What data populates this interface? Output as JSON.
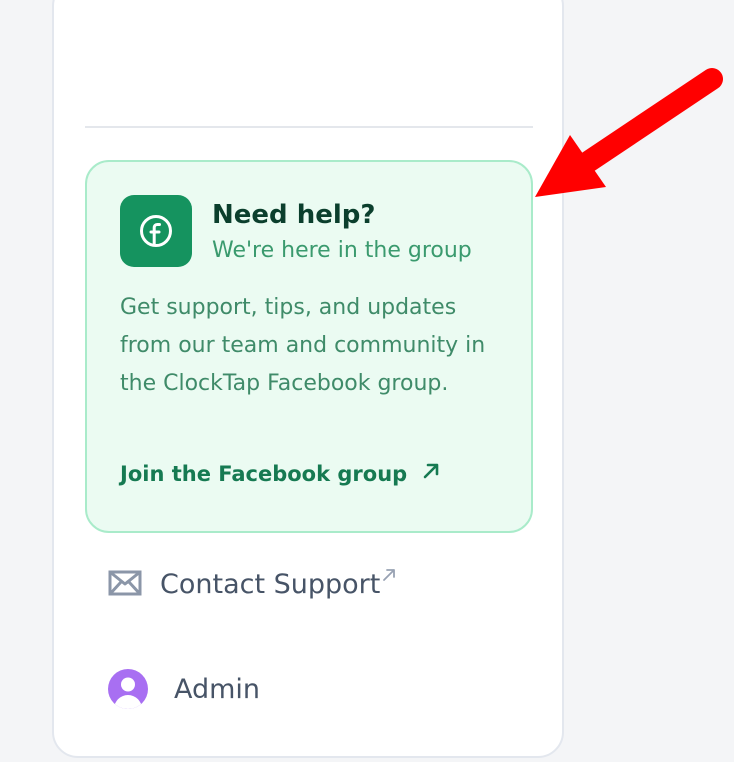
{
  "help_card": {
    "title": "Need help?",
    "subtitle": "We're here in the group",
    "body": "Get support, tips, and updates from our team and community in the ClockTap Facebook group.",
    "link_label": "Join the Facebook group",
    "link_icon": "arrow-up-right-icon",
    "badge_icon": "facebook-icon"
  },
  "nav": {
    "contact_label": "Contact Support",
    "contact_icon": "mail-icon",
    "contact_external_icon": "external-link-icon",
    "admin_label": "Admin",
    "admin_icon": "user-avatar-icon"
  },
  "colors": {
    "card_background": "#ebfbf2",
    "card_border": "#a9ebca",
    "brand_green": "#15935f",
    "title_green": "#0b3f2d",
    "link_green": "#167a52",
    "nav_text": "#475467",
    "avatar_purple": "#a86ff2",
    "annotation_arrow": "#ff0000"
  }
}
